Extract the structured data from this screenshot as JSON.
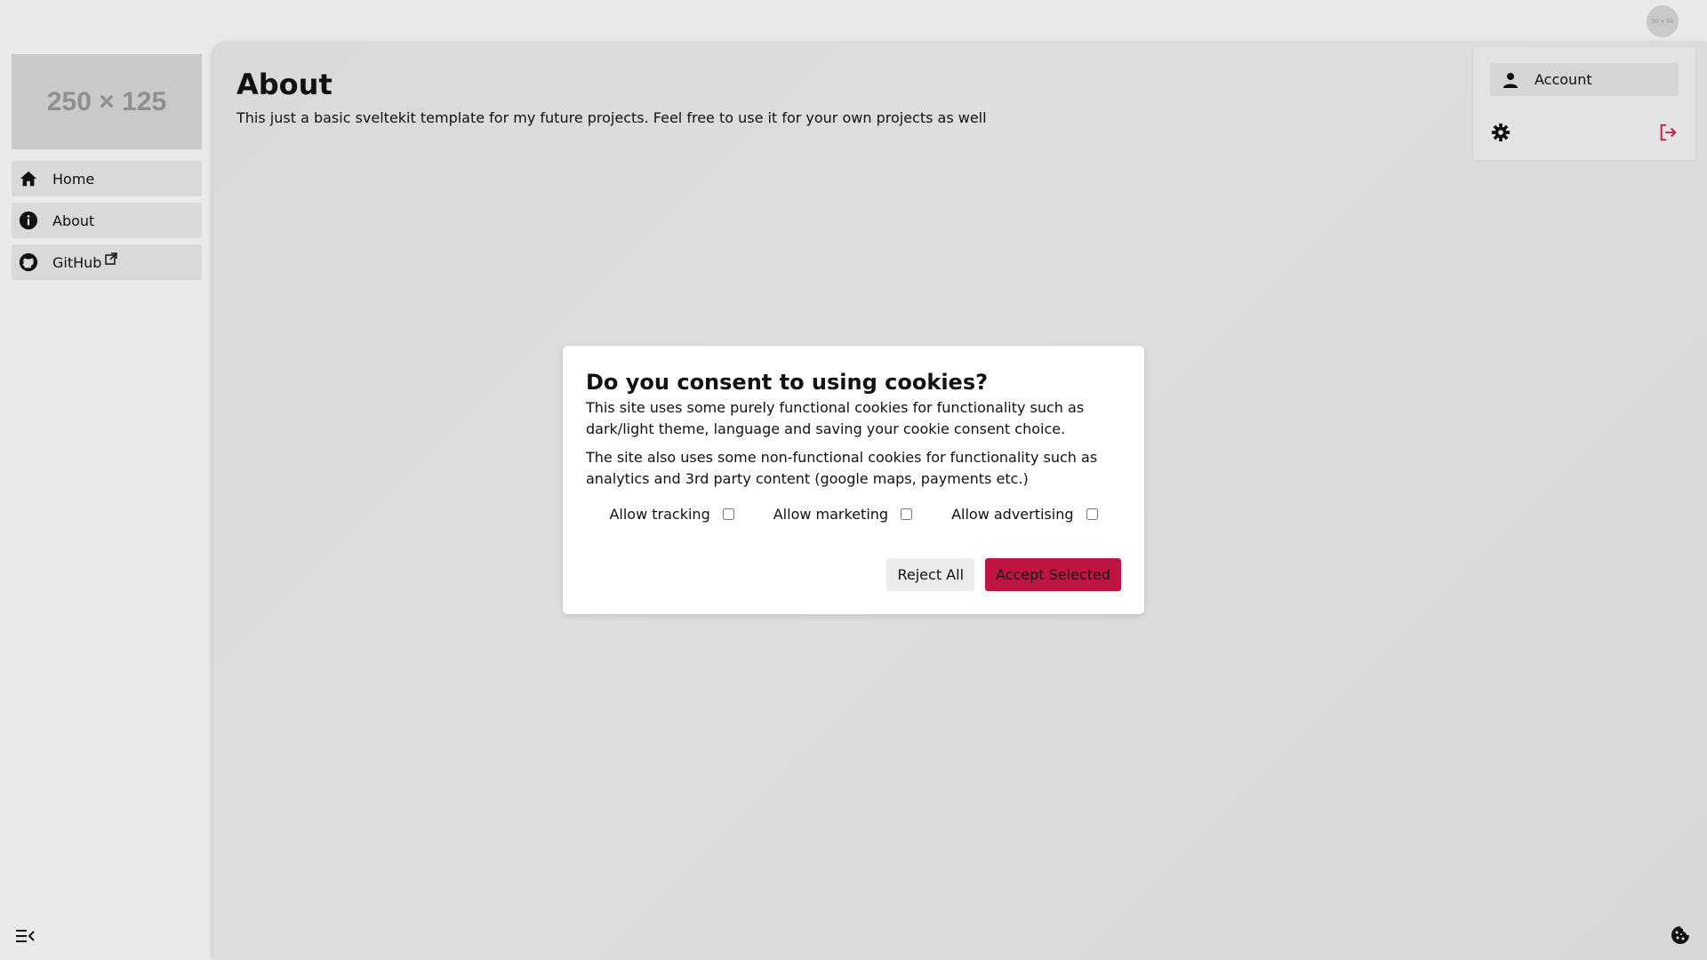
{
  "topbar": {
    "avatar_text": "50 × 50"
  },
  "sidebar": {
    "logo_text": "250 × 125",
    "items": [
      {
        "label": "Home",
        "icon": "home-icon"
      },
      {
        "label": "About",
        "icon": "info-icon"
      },
      {
        "label": "GitHub",
        "icon": "github-icon",
        "external": true
      }
    ],
    "collapse_icon": "menu-collapse-icon"
  },
  "main": {
    "title": "About",
    "description": "This just a basic sveltekit template for my future projects. Feel free to use it for your own projects as well"
  },
  "account_menu": {
    "account_label": "Account",
    "settings_icon": "gear-icon",
    "logout_icon": "logout-icon"
  },
  "cookie_dialog": {
    "title": "Do you consent to using cookies?",
    "paragraph1": "This site uses some purely functional cookies for functionality such as dark/light theme, language and saving your cookie consent choice.",
    "paragraph2": "The site also uses some non-functional cookies for functionality such as analytics and 3rd party content (google maps, payments etc.)",
    "options": [
      {
        "label": "Allow tracking",
        "checked": false
      },
      {
        "label": "Allow marketing",
        "checked": false
      },
      {
        "label": "Allow advertising",
        "checked": false
      }
    ],
    "reject_label": "Reject All",
    "accept_label": "Accept Selected"
  },
  "colors": {
    "accent": "#be1543",
    "background": "#e9e9e9",
    "panel": "#dcdcdc"
  },
  "cookie_fab_icon": "cookie-icon"
}
